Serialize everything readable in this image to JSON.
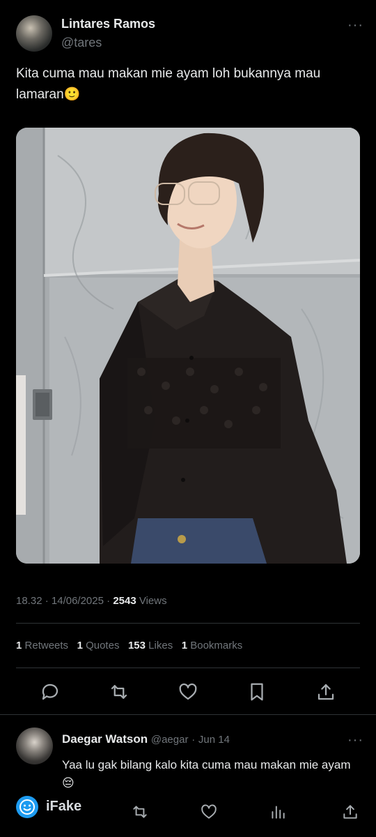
{
  "author": {
    "name": "Lintares Ramos",
    "handle": "@tares"
  },
  "tweet": {
    "text": "Kita cuma mau makan mie ayam loh bukannya mau lamaran🙂",
    "time": "18.32",
    "date": "14/06/2025",
    "views_count": "2543",
    "views_label": "Views"
  },
  "stats": {
    "retweets_count": "1",
    "retweets_label": "Retweets",
    "quotes_count": "1",
    "quotes_label": "Quotes",
    "likes_count": "153",
    "likes_label": "Likes",
    "bookmarks_count": "1",
    "bookmarks_label": "Bookmarks"
  },
  "actions": [
    "reply-icon",
    "retweet-icon",
    "like-icon",
    "bookmark-icon",
    "share-icon"
  ],
  "reply": {
    "name": "Daegar Watson",
    "handle": "@aegar",
    "date": "Jun 14",
    "text": "Yaa lu gak bilang kalo kita cuma mau makan mie ayam😔"
  },
  "watermark": "iFake",
  "colors": {
    "background": "#000000",
    "text": "#e7e9ea",
    "secondary": "#71767b",
    "divider": "#2f3336",
    "watermark_badge": "#1d9bf0"
  }
}
